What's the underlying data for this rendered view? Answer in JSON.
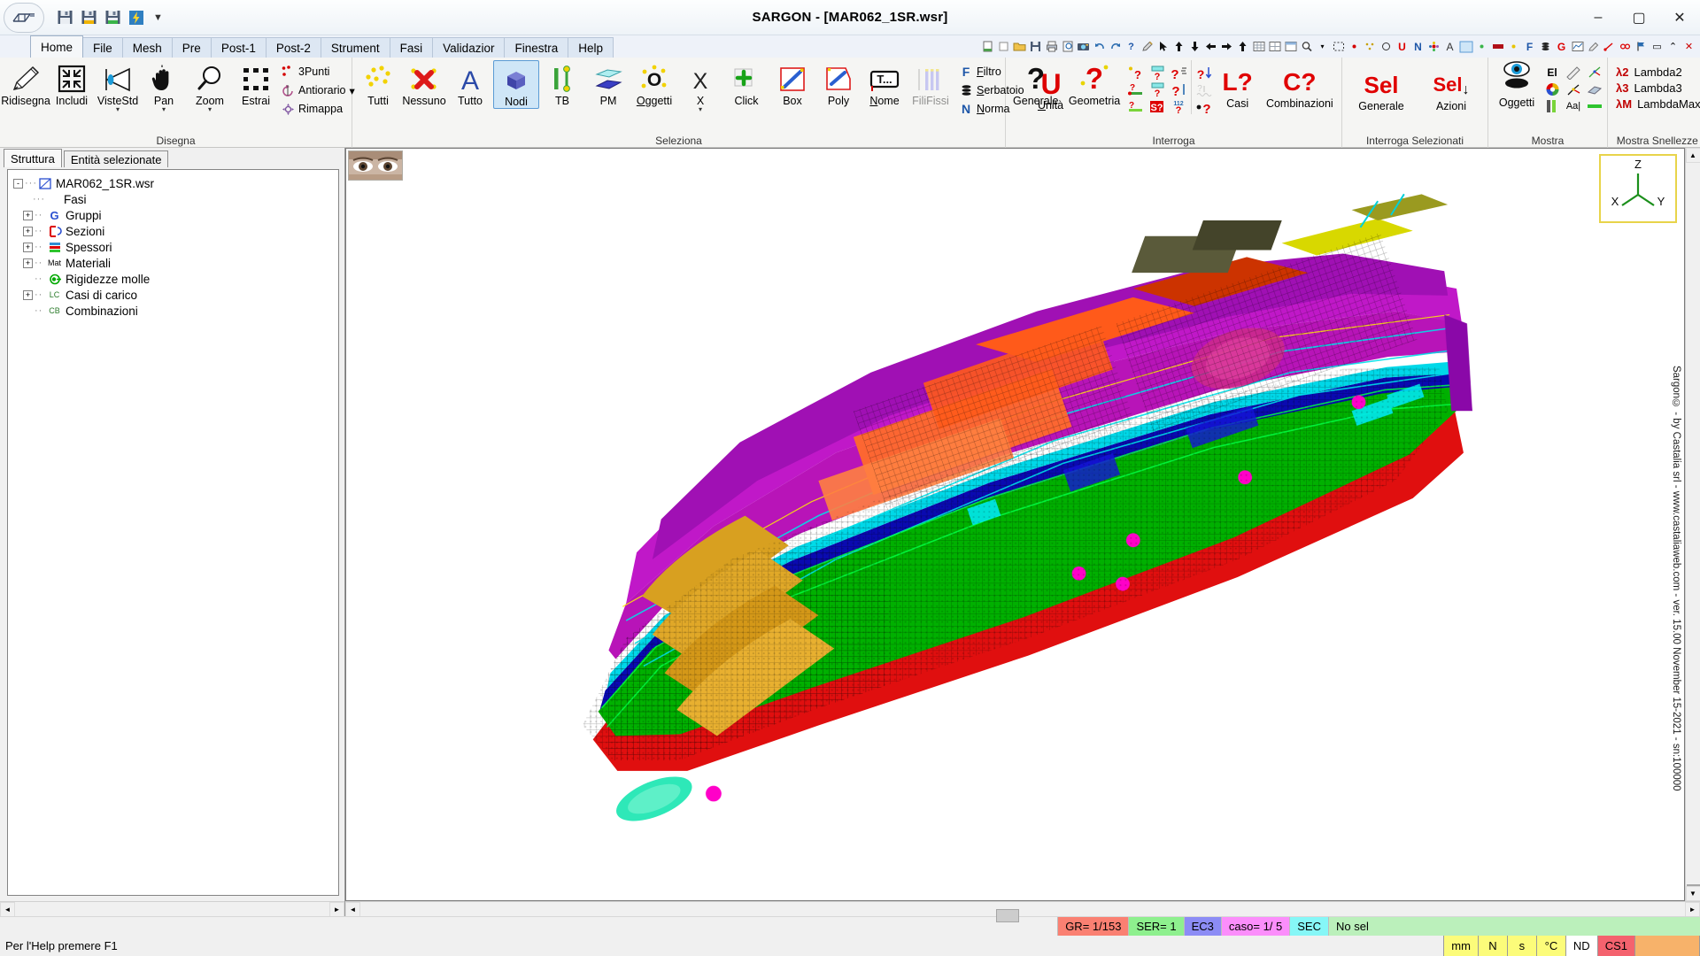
{
  "window": {
    "title": "SARGON - [MAR062_1SR.wsr]",
    "minimize": "–",
    "maximize": "▢",
    "close": "✕",
    "quick_access": [
      "save-icon",
      "save-yellow-icon",
      "save-green-icon",
      "lightning-icon"
    ],
    "qat_more": "▼"
  },
  "tabs": [
    {
      "label": "Home",
      "active": true
    },
    {
      "label": "File",
      "active": false
    },
    {
      "label": "Mesh",
      "active": false
    },
    {
      "label": "Pre",
      "active": false
    },
    {
      "label": "Post-1",
      "active": false
    },
    {
      "label": "Post-2",
      "active": false
    },
    {
      "label": "Strument",
      "active": false
    },
    {
      "label": "Fasi",
      "active": false
    },
    {
      "label": "Validazior",
      "active": false
    },
    {
      "label": "Finestra",
      "active": false
    },
    {
      "label": "Help",
      "active": false
    }
  ],
  "ribbon": {
    "groups": [
      {
        "title": "Disegna",
        "buttons": [
          {
            "label": "Ridisegna",
            "icon": "pencil-icon",
            "dropdown": false
          },
          {
            "label": "Includi",
            "icon": "fit-arrows-icon",
            "dropdown": false
          },
          {
            "label": "VisteStd",
            "icon": "view-eye-triangle-icon",
            "dropdown": true
          },
          {
            "label": "Pan",
            "icon": "hand-icon",
            "dropdown": true
          },
          {
            "label": "Zoom",
            "icon": "magnifier-icon",
            "dropdown": true
          },
          {
            "label": "Estrai",
            "icon": "marquee-icon",
            "dropdown": false
          }
        ],
        "stack": [
          {
            "label": "3Punti",
            "icon": "three-points-icon",
            "dropdown": false
          },
          {
            "label": "Antiorario",
            "icon": "rotate-ccw-icon",
            "dropdown": true
          },
          {
            "label": "Rimappa",
            "icon": "remap-icon",
            "dropdown": false
          }
        ]
      },
      {
        "title": "Seleziona",
        "buttons": [
          {
            "label": "Tutti",
            "icon": "select-all-nodes-icon",
            "dropdown": false
          },
          {
            "label": "Nessuno",
            "icon": "deselect-x-icon",
            "dropdown": false
          },
          {
            "label": "Tutto",
            "icon": "letter-a-icon",
            "dropdown": false
          },
          {
            "label": "Nodi",
            "icon": "cube-node-icon",
            "dropdown": false,
            "selected": true
          },
          {
            "label": "TB",
            "icon": "beam-truss-icon",
            "dropdown": false
          },
          {
            "label": "PM",
            "icon": "plate-icon",
            "dropdown": false
          },
          {
            "label": "Oggetti",
            "icon": "objects-o-icon",
            "dropdown": false,
            "mnemonic": "O"
          },
          {
            "label": "X",
            "icon": "letter-x-icon",
            "dropdown": true
          },
          {
            "label": "Click",
            "icon": "click-plus-icon",
            "dropdown": false
          },
          {
            "label": "Box",
            "icon": "box-select-icon",
            "dropdown": false
          },
          {
            "label": "Poly",
            "icon": "poly-select-icon",
            "dropdown": false
          },
          {
            "label": "Nome",
            "icon": "name-tag-icon",
            "dropdown": false,
            "mnemonic": "N"
          },
          {
            "label": "FiliFissi",
            "icon": "fili-fissi-icon",
            "dropdown": false,
            "disabled": true
          }
        ],
        "stack": [
          {
            "label": "Filtro",
            "icon": "letter-f-icon",
            "key": "F"
          },
          {
            "label": "Serbatoio",
            "icon": "tank-icon",
            "key": ""
          },
          {
            "label": "Norma",
            "icon": "letter-n-icon",
            "key": "N"
          }
        ],
        "extra": [
          {
            "label": "Unità",
            "icon": "letter-u-red-icon"
          }
        ]
      },
      {
        "title": "Interroga",
        "buttons": [
          {
            "label": "Generale",
            "icon": "question-black-icon"
          },
          {
            "label": "Geometria",
            "icon": "question-red-icon"
          }
        ],
        "minigrid": [
          [
            "query-node-icon",
            "query-tb-icon",
            "query-stress-icon"
          ],
          [
            "query-beam-icon",
            "query-plate-icon",
            "query-line-icon"
          ],
          [
            "query-green-beam-icon",
            "query-s-red-icon",
            "query-112-icon"
          ]
        ],
        "minigrid2": [
          [
            "query-down-arrow-icon"
          ],
          [
            "query-wave-icon"
          ],
          [
            "query-dot-icon"
          ]
        ],
        "buttons2": [
          {
            "label": "Casi",
            "icon": "L?"
          },
          {
            "label": "Combinazioni",
            "icon": "C?"
          }
        ]
      },
      {
        "title": "Interroga Selezionati",
        "buttons": [
          {
            "label": "Generale",
            "icon": "Sel"
          },
          {
            "label": "Azioni",
            "icon": "Sel↓"
          }
        ]
      },
      {
        "title": "Mostra",
        "buttons": [
          {
            "label": "Oggetti",
            "icon": "eye-icon"
          }
        ],
        "minigrid": [
          [
            "El",
            "ruler-icon",
            "node-axes-icon"
          ],
          [
            "color-wheel-icon",
            "axes-icon",
            "shade-icon"
          ],
          [
            "bars-icon",
            "Aa",
            "green-bar-icon"
          ]
        ]
      },
      {
        "title": "Mostra Snellezze",
        "lambdas": [
          {
            "key": "λ2",
            "label": "Lambda2"
          },
          {
            "key": "λ3",
            "label": "Lambda3"
          },
          {
            "key": "λM",
            "label": "LambdaMax"
          }
        ]
      }
    ]
  },
  "left_panel": {
    "tabs": [
      {
        "label": "Struttura",
        "active": true
      },
      {
        "label": "Entità selezionate",
        "active": false
      }
    ],
    "tree": [
      {
        "label": "MAR062_1SR.wsr",
        "level": 0,
        "expander": "-",
        "icon": "model-file-icon"
      },
      {
        "label": "Fasi",
        "level": 1,
        "expander": "",
        "icon": ""
      },
      {
        "label": "Gruppi",
        "level": 1,
        "expander": "+",
        "icon": "G"
      },
      {
        "label": "Sezioni",
        "level": 1,
        "expander": "+",
        "icon": "section-icon"
      },
      {
        "label": "Spessori",
        "level": 1,
        "expander": "+",
        "icon": "thickness-icon"
      },
      {
        "label": "Materiali",
        "level": 1,
        "expander": "+",
        "icon": "Mat"
      },
      {
        "label": "Rigidezze molle",
        "level": 1,
        "expander": "",
        "icon": "spring-icon"
      },
      {
        "label": "Casi di carico",
        "level": 1,
        "expander": "+",
        "icon": "LC"
      },
      {
        "label": "Combinazioni",
        "level": 1,
        "expander": "",
        "icon": "CB"
      }
    ]
  },
  "viewport": {
    "axis_labels": {
      "z": "Z",
      "x": "X",
      "y": "Y"
    },
    "brand": "Sargon© - by Castalia srl - www.castaliaweb.com - ver. 15.00 November 15-2021 - sn:100000",
    "model_name": "cruise-ship-fem-mesh"
  },
  "status": {
    "cells": [
      {
        "text": "GR=  1/153",
        "bg": "#fa8072",
        "name": "group-indicator"
      },
      {
        "text": "SER= 1",
        "bg": "#8ef08e",
        "name": "series-indicator"
      },
      {
        "text": "EC3",
        "bg": "#8c8cf5",
        "name": "code-indicator"
      },
      {
        "text": "caso=   1/  5",
        "bg": "#fb8efb",
        "name": "case-indicator"
      },
      {
        "text": "SEC",
        "bg": "#86f7f7",
        "name": "section-indicator"
      },
      {
        "text": "No sel",
        "bg": "#bbf0bb",
        "name": "selection-indicator"
      }
    ]
  },
  "bottom": {
    "help_text": "Per l'Help premere F1",
    "units": [
      {
        "text": "mm",
        "bg": "#fcfc7a",
        "name": "unit-length"
      },
      {
        "text": "N",
        "bg": "#fcfc7a",
        "name": "unit-force"
      },
      {
        "text": "s",
        "bg": "#fcfc7a",
        "name": "unit-time"
      },
      {
        "text": "°C",
        "bg": "#fcfc7a",
        "name": "unit-temperature"
      },
      {
        "text": "ND",
        "bg": "#ffffff",
        "name": "unit-nd"
      },
      {
        "text": "CS1",
        "bg": "#f4626e",
        "name": "coordinate-system"
      },
      {
        "text": "",
        "bg": "#f7b26a",
        "name": "progress-indicator"
      }
    ]
  }
}
